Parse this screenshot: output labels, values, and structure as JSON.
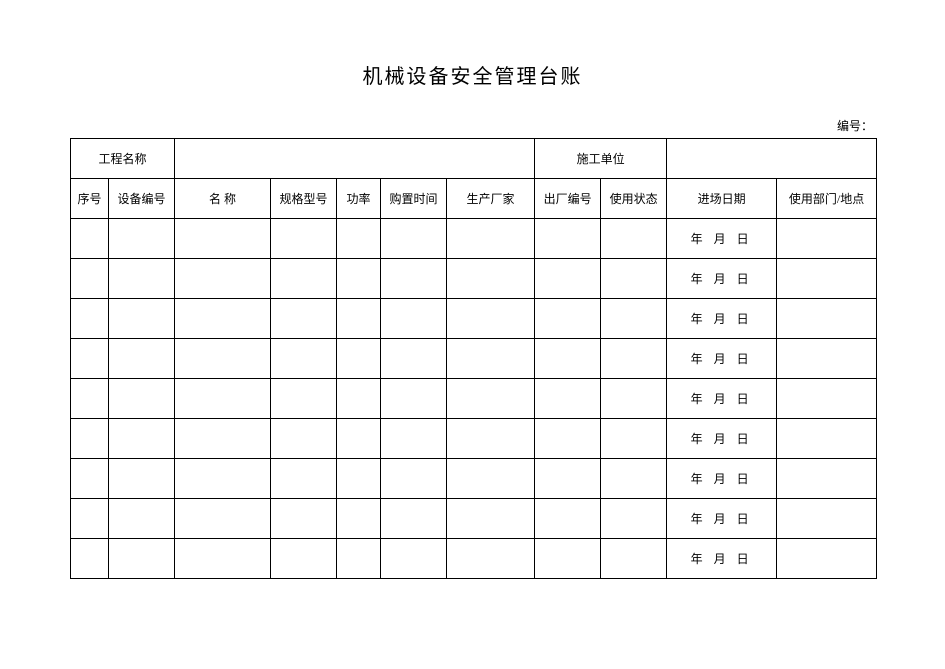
{
  "title": "机械设备安全管理台账",
  "serial_label": "编号：",
  "info": {
    "project_label": "工程名称",
    "project_value": "",
    "contractor_label": "施工单位",
    "contractor_value": ""
  },
  "columns": {
    "seq": "序号",
    "device_no": "设备编号",
    "name": "名 称",
    "spec": "规格型号",
    "power": "功率",
    "purchase_time": "购置时间",
    "manufacturer": "生产厂家",
    "factory_no": "出厂编号",
    "status": "使用状态",
    "entry_date": "进场日期",
    "dept_location": "使用部门/地点"
  },
  "date_template": "年 月 日",
  "rows": [
    {
      "seq": "",
      "device_no": "",
      "name": "",
      "spec": "",
      "power": "",
      "purchase_time": "",
      "manufacturer": "",
      "factory_no": "",
      "status": "",
      "entry_date": "年 月 日",
      "dept_location": ""
    },
    {
      "seq": "",
      "device_no": "",
      "name": "",
      "spec": "",
      "power": "",
      "purchase_time": "",
      "manufacturer": "",
      "factory_no": "",
      "status": "",
      "entry_date": "年 月 日",
      "dept_location": ""
    },
    {
      "seq": "",
      "device_no": "",
      "name": "",
      "spec": "",
      "power": "",
      "purchase_time": "",
      "manufacturer": "",
      "factory_no": "",
      "status": "",
      "entry_date": "年 月 日",
      "dept_location": ""
    },
    {
      "seq": "",
      "device_no": "",
      "name": "",
      "spec": "",
      "power": "",
      "purchase_time": "",
      "manufacturer": "",
      "factory_no": "",
      "status": "",
      "entry_date": "年 月 日",
      "dept_location": ""
    },
    {
      "seq": "",
      "device_no": "",
      "name": "",
      "spec": "",
      "power": "",
      "purchase_time": "",
      "manufacturer": "",
      "factory_no": "",
      "status": "",
      "entry_date": "年 月 日",
      "dept_location": ""
    },
    {
      "seq": "",
      "device_no": "",
      "name": "",
      "spec": "",
      "power": "",
      "purchase_time": "",
      "manufacturer": "",
      "factory_no": "",
      "status": "",
      "entry_date": "年 月 日",
      "dept_location": ""
    },
    {
      "seq": "",
      "device_no": "",
      "name": "",
      "spec": "",
      "power": "",
      "purchase_time": "",
      "manufacturer": "",
      "factory_no": "",
      "status": "",
      "entry_date": "年 月 日",
      "dept_location": ""
    },
    {
      "seq": "",
      "device_no": "",
      "name": "",
      "spec": "",
      "power": "",
      "purchase_time": "",
      "manufacturer": "",
      "factory_no": "",
      "status": "",
      "entry_date": "年 月 日",
      "dept_location": ""
    },
    {
      "seq": "",
      "device_no": "",
      "name": "",
      "spec": "",
      "power": "",
      "purchase_time": "",
      "manufacturer": "",
      "factory_no": "",
      "status": "",
      "entry_date": "年 月 日",
      "dept_location": ""
    }
  ]
}
